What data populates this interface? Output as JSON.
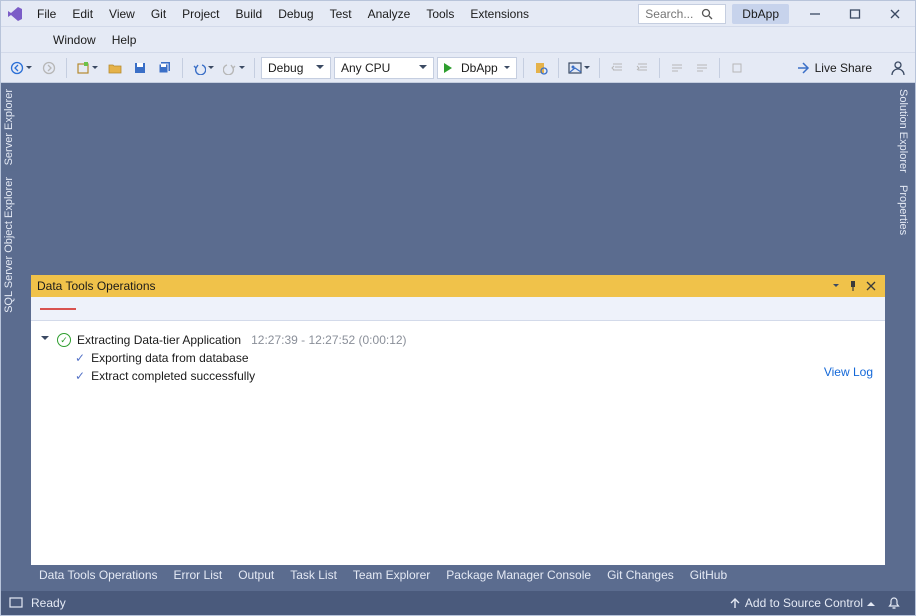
{
  "menu": {
    "row1": [
      "File",
      "Edit",
      "View",
      "Git",
      "Project",
      "Build",
      "Debug",
      "Test",
      "Analyze",
      "Tools",
      "Extensions"
    ],
    "row2": [
      "Window",
      "Help"
    ]
  },
  "search": {
    "placeholder": "Search..."
  },
  "solution_pill": "DbApp",
  "toolbar": {
    "config_selected": "Debug",
    "platform_selected": "Any CPU",
    "start_label": "DbApp",
    "live_share_label": "Live Share"
  },
  "side_tabs": {
    "left": [
      "Server Explorer",
      "SQL Server Object Explorer"
    ],
    "right": [
      "Solution Explorer",
      "Properties"
    ]
  },
  "panel": {
    "title": "Data Tools Operations",
    "op_title": "Extracting Data-tier Application",
    "op_time": "12:27:39 - 12:27:52 (0:00:12)",
    "sub1": "Exporting data from database",
    "sub2": "Extract completed successfully",
    "view_log": "View Log"
  },
  "bottom_tabs": [
    "Data Tools Operations",
    "Error List",
    "Output",
    "Task List",
    "Team Explorer",
    "Package Manager Console",
    "Git Changes",
    "GitHub"
  ],
  "status": {
    "ready": "Ready",
    "add_source": "Add to Source Control"
  }
}
